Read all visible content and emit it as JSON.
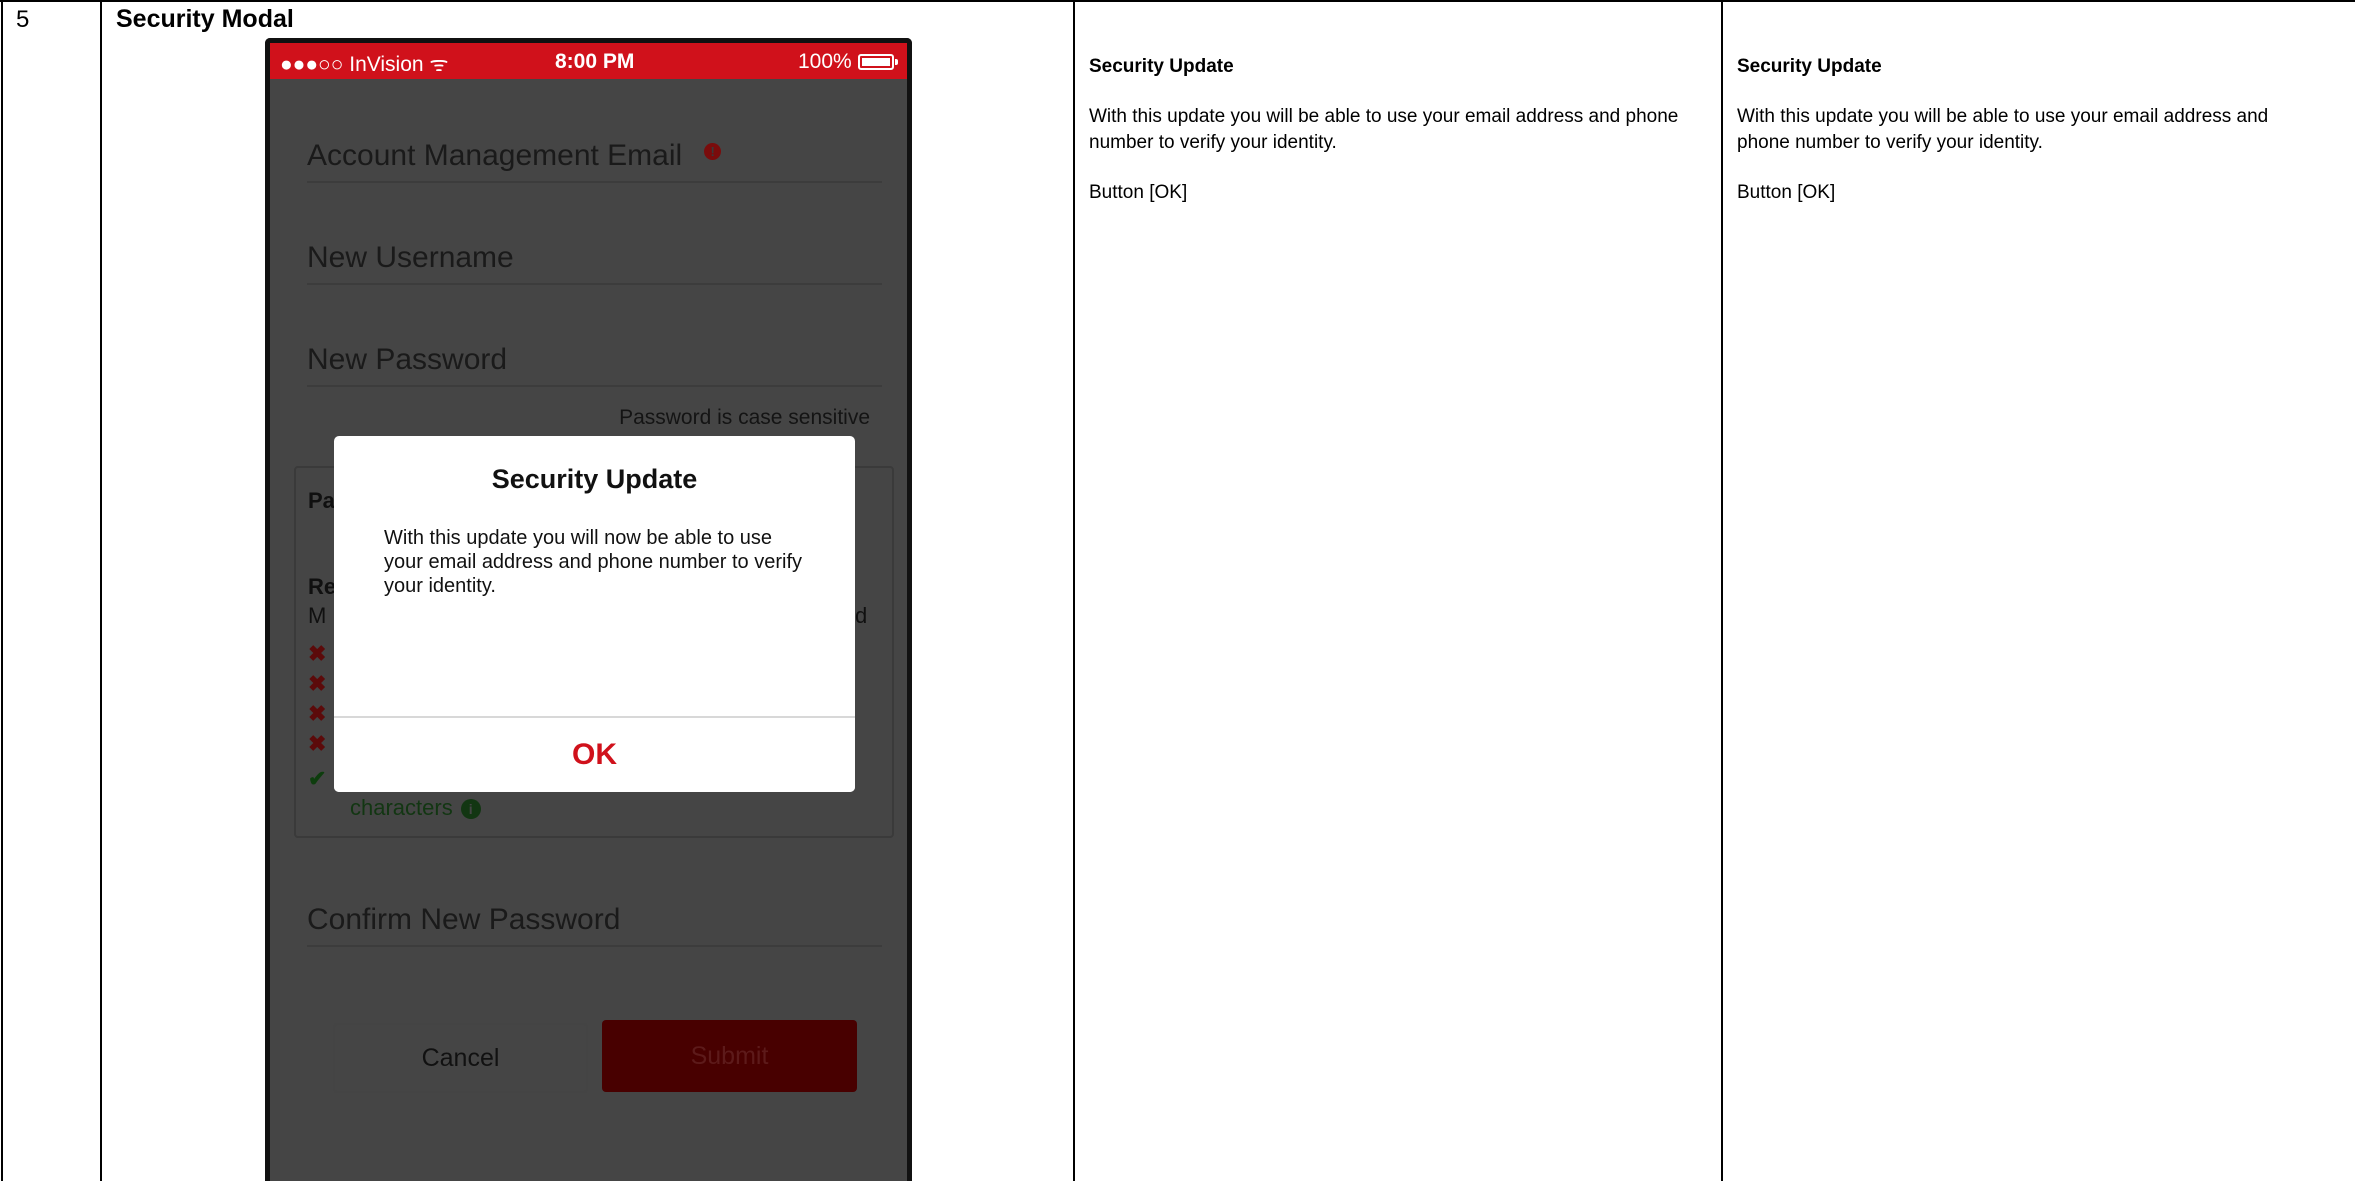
{
  "row": {
    "number": "5",
    "title": "Security Modal"
  },
  "phone": {
    "status_bar": {
      "carrier": "●●●○○ InVision ᯤ",
      "time": "8:00 PM",
      "battery": "100%"
    },
    "fields": {
      "account_email": "Account Management Email",
      "new_username": "New Username",
      "new_password": "New Password",
      "password_hint": "Password is case sensitive",
      "confirm_password": "Confirm New Password"
    },
    "requirements": {
      "frag_pa": "Pa",
      "frag_re": "Re",
      "frag_m": "M",
      "frag_d": "d",
      "green_text": "characters"
    },
    "alert_icon": "!",
    "info_icon": "i",
    "buttons": {
      "cancel": "Cancel",
      "submit": "Submit"
    },
    "modal": {
      "title": "Security Update",
      "body": "With this update you will now be able to use your email address and phone number to verify your identity.",
      "ok": "OK"
    }
  },
  "columns": [
    {
      "heading": "Security Update",
      "body": "With this update you will be able to use your email address and phone number to verify your identity.",
      "button": "Button [OK]"
    },
    {
      "heading": "Security Update",
      "body": "With this update you will be able to use your email address and phone number to verify your identity.",
      "button": "Button [OK]"
    }
  ],
  "colors": {
    "brand_red": "#d0111b",
    "overlay": "#454545"
  }
}
